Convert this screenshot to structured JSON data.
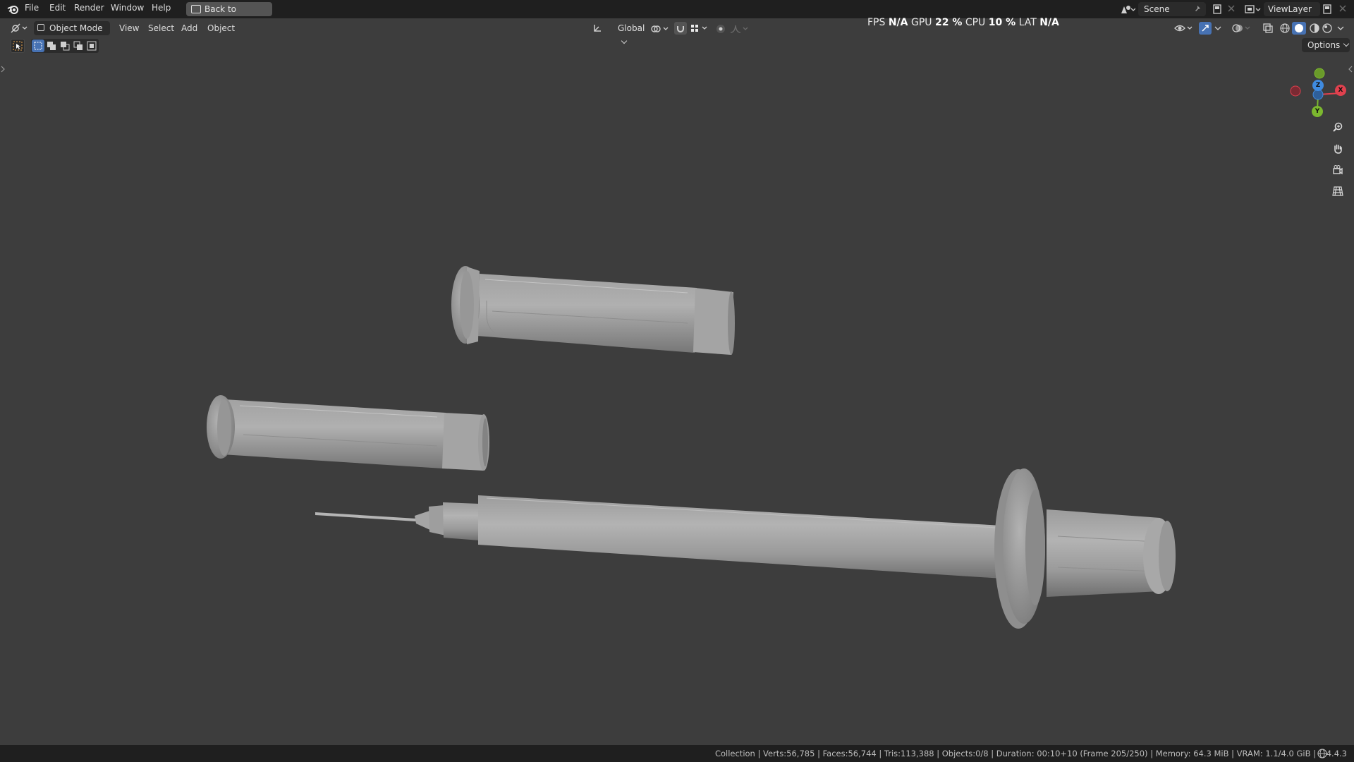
{
  "topbar": {
    "menu": [
      "File",
      "Edit",
      "Render",
      "Window",
      "Help"
    ],
    "back_button": "Back to Previous",
    "scene_name": "Scene",
    "view_layer": "ViewLayer"
  },
  "viewport_header": {
    "mode": "Object Mode",
    "menus": [
      "View",
      "Select",
      "Add",
      "Object"
    ],
    "transform_orientation": "Global",
    "options": "Options"
  },
  "performance": {
    "fps_label": "FPS",
    "fps_value": "N/A",
    "gpu_label": "GPU",
    "gpu_value": "22 %",
    "cpu_label": "CPU",
    "cpu_value": "10 %",
    "lat_label": "LAT",
    "lat_value": "N/A"
  },
  "gizmo": {
    "x_label": "X",
    "y_label": "Y",
    "z_label": "Z"
  },
  "icons": {
    "blender_logo": "blender-icon",
    "editor_type": "3d-viewport-icon",
    "navigate": [
      "zoom-icon",
      "hand-pan-icon",
      "camera-icon",
      "grid-icon"
    ]
  },
  "statusbar": {
    "stats": "Collection | Verts:56,785 | Faces:56,744 | Tris:113,388 | Objects:0/8 | Duration: 00:10+10 (Frame 205/250) | Memory: 64.3 MiB | VRAM: 1.1/4.0 GiB |",
    "version": "4.4.3"
  },
  "colors": {
    "viewport_bg": "#3d3d3d",
    "x_axis": "#e0414e",
    "y_axis": "#7cb82f",
    "z_axis": "#3f8be0",
    "accent": "#4772b3"
  }
}
